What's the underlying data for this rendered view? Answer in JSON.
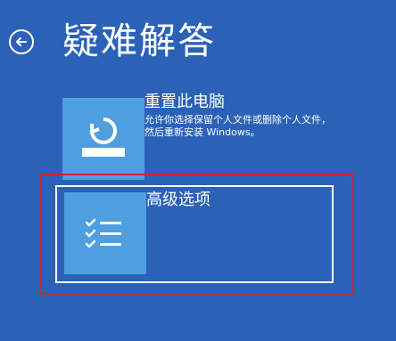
{
  "page": {
    "title": "疑难解答",
    "background_color": "#2b62b7"
  },
  "header": {
    "back_icon": "arrow-left-circle-icon"
  },
  "options": [
    {
      "id": "reset",
      "title": "重置此电脑",
      "description": "允许你选择保留个人文件或删除个人文件，然后重新安装 Windows。",
      "icon": "reset-pc-icon"
    },
    {
      "id": "advanced",
      "title": "高级选项",
      "icon": "checklist-icon",
      "selected": true
    }
  ],
  "colors": {
    "tile": "#4f9ee0",
    "highlight": "#d3222e"
  }
}
